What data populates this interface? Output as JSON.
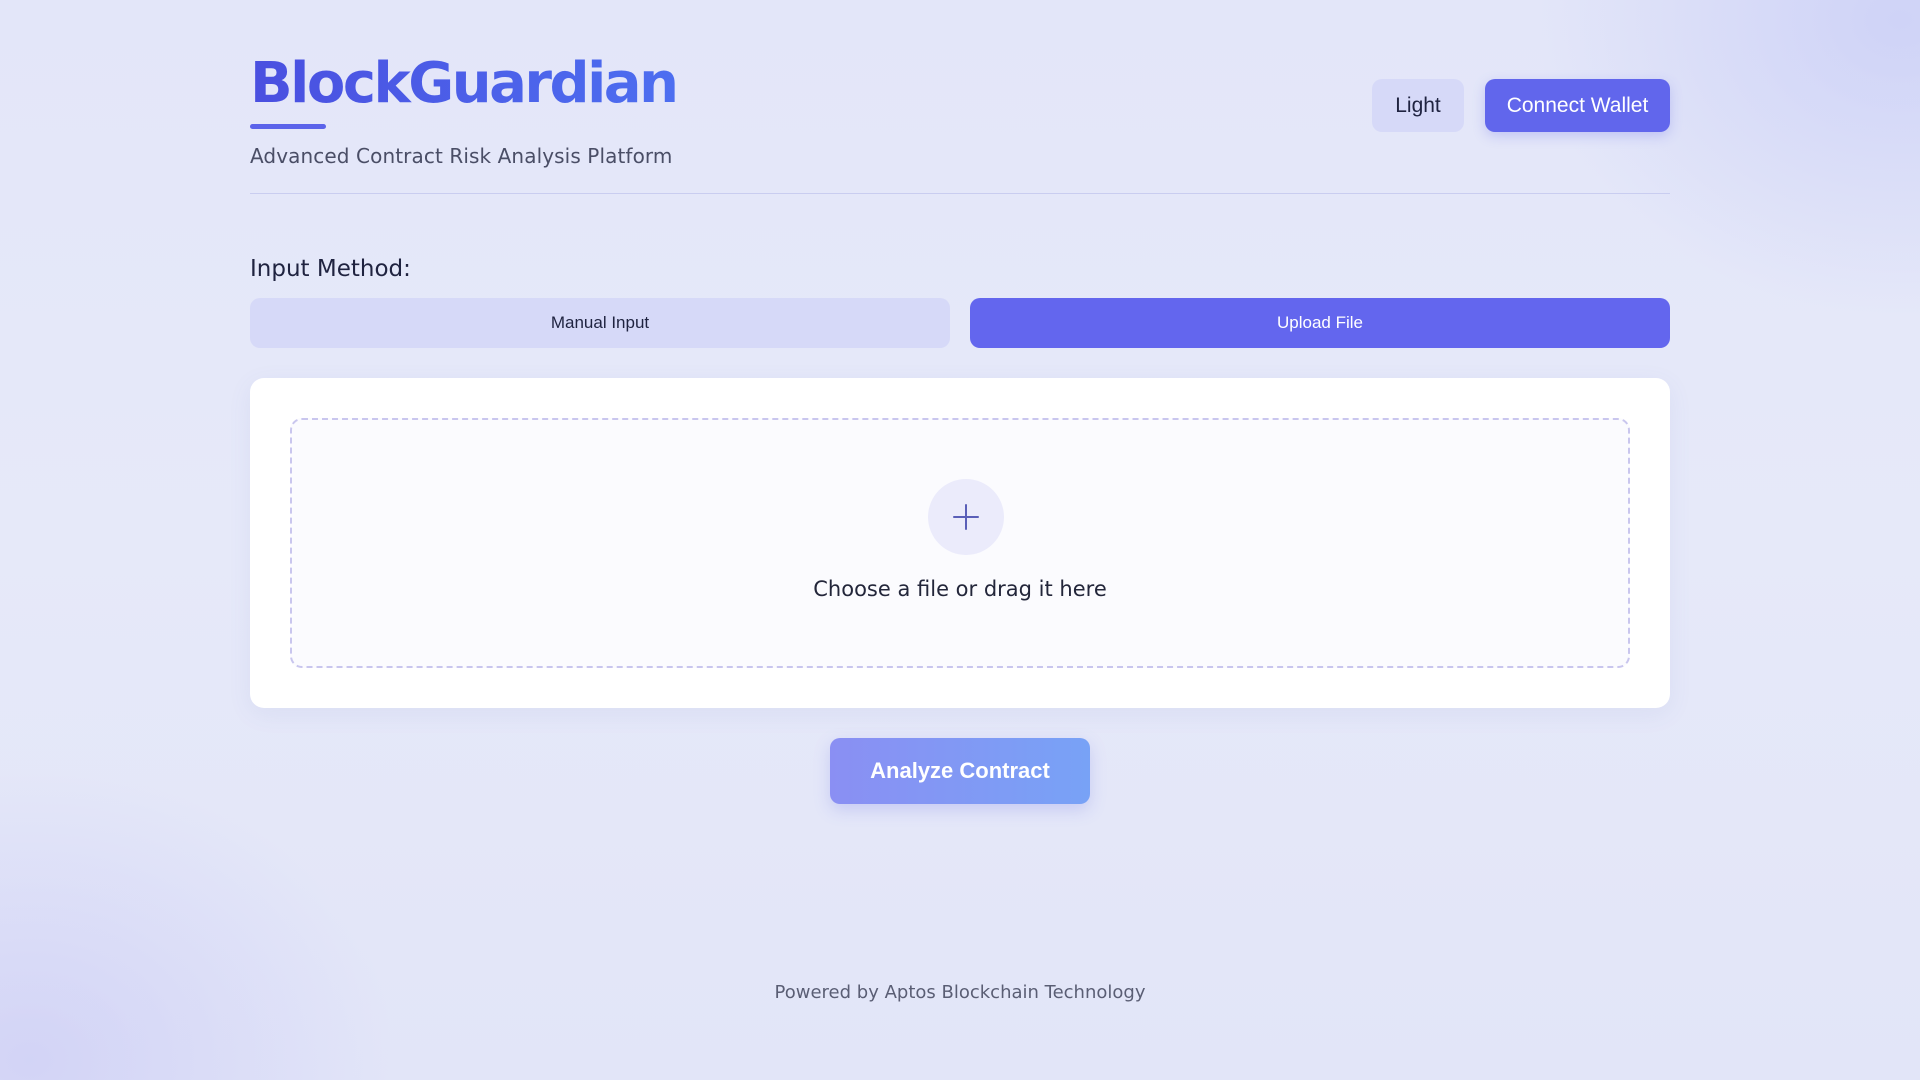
{
  "header": {
    "title": "BlockGuardian",
    "subtitle": "Advanced Contract Risk Analysis Platform",
    "theme_button_label": "Light",
    "wallet_button_label": "Connect Wallet"
  },
  "input_method": {
    "label": "Input Method:",
    "tabs": [
      {
        "label": "Manual Input",
        "active": false
      },
      {
        "label": "Upload File",
        "active": true
      }
    ]
  },
  "upload": {
    "icon": "plus-icon",
    "prompt": "Choose a file or drag it here"
  },
  "actions": {
    "analyze_label": "Analyze Contract"
  },
  "footer": {
    "text": "Powered by Aptos Blockchain Technology"
  },
  "colors": {
    "accent": "#6366ee",
    "brand": "#4557e6",
    "secondary_button": "#d6d9f8",
    "background": "#e4e7f9"
  }
}
